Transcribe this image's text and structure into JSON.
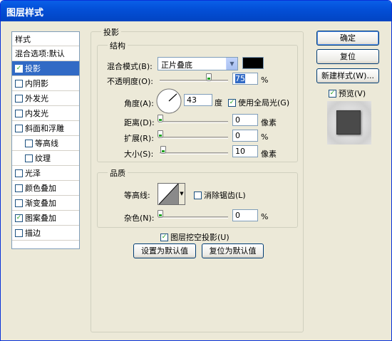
{
  "window": {
    "title": "图层样式"
  },
  "left_list": {
    "header": "样式",
    "items": [
      {
        "label": "混合选项:默认",
        "checkbox": false,
        "checked": false,
        "selected": false,
        "indent": false
      },
      {
        "label": "投影",
        "checkbox": true,
        "checked": true,
        "selected": true,
        "indent": false
      },
      {
        "label": "内阴影",
        "checkbox": true,
        "checked": false,
        "selected": false,
        "indent": false
      },
      {
        "label": "外发光",
        "checkbox": true,
        "checked": false,
        "selected": false,
        "indent": false
      },
      {
        "label": "内发光",
        "checkbox": true,
        "checked": false,
        "selected": false,
        "indent": false
      },
      {
        "label": "斜面和浮雕",
        "checkbox": true,
        "checked": false,
        "selected": false,
        "indent": false
      },
      {
        "label": "等高线",
        "checkbox": true,
        "checked": false,
        "selected": false,
        "indent": true
      },
      {
        "label": "纹理",
        "checkbox": true,
        "checked": false,
        "selected": false,
        "indent": true
      },
      {
        "label": "光泽",
        "checkbox": true,
        "checked": false,
        "selected": false,
        "indent": false
      },
      {
        "label": "颜色叠加",
        "checkbox": true,
        "checked": false,
        "selected": false,
        "indent": false
      },
      {
        "label": "渐变叠加",
        "checkbox": true,
        "checked": false,
        "selected": false,
        "indent": false
      },
      {
        "label": "图案叠加",
        "checkbox": true,
        "checked": true,
        "selected": false,
        "indent": false
      },
      {
        "label": "描边",
        "checkbox": true,
        "checked": false,
        "selected": false,
        "indent": false
      }
    ]
  },
  "drop_shadow": {
    "title": "投影",
    "structure": {
      "title": "结构",
      "blend_mode_label": "混合模式(B):",
      "blend_mode_value": "正片叠底",
      "shadow_color": "#000000",
      "opacity_label": "不透明度(O):",
      "opacity_value": "75",
      "opacity_unit": "%",
      "opacity_level": 0.75,
      "angle_label": "角度(A):",
      "angle_value": "43",
      "angle_unit": "度",
      "global_light_label": "使用全局光(G)",
      "global_light_checked": true,
      "distance_label": "距离(D):",
      "distance_value": "0",
      "distance_unit": "像素",
      "distance_level": 0.0,
      "spread_label": "扩展(R):",
      "spread_value": "0",
      "spread_unit": "%",
      "spread_level": 0.0,
      "size_label": "大小(S):",
      "size_value": "10",
      "size_unit": "像素",
      "size_level": 0.04
    },
    "quality": {
      "title": "品质",
      "contour_label": "等高线:",
      "antialias_label": "消除锯齿(L)",
      "antialias_checked": false,
      "noise_label": "杂色(N):",
      "noise_value": "0",
      "noise_unit": "%",
      "noise_level": 0.0
    },
    "knockout_label": "图层挖空投影(U)",
    "knockout_checked": true,
    "set_default_label": "设置为默认值",
    "reset_default_label": "复位为默认值"
  },
  "buttons": {
    "ok": "确定",
    "reset": "复位",
    "new_style": "新建样式(W)...",
    "preview_label": "预览(V)",
    "preview_checked": true
  }
}
